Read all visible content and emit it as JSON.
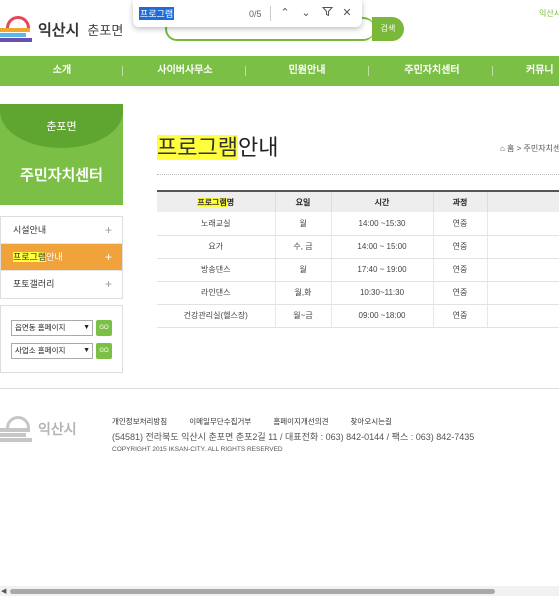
{
  "header": {
    "city": "익산시",
    "town": "춘포면",
    "search_label": "검색",
    "top_link": "익산시"
  },
  "findbar": {
    "query": "프로그램",
    "count": "0/5"
  },
  "nav": {
    "items": [
      "소개",
      "사이버사무소",
      "민원안내",
      "주민자치센터",
      "커뮤니"
    ]
  },
  "sidebar": {
    "town": "춘포면",
    "title": "주민자치센터",
    "items": [
      {
        "label_pre": "시설안내",
        "label_hl": "",
        "label_post": ""
      },
      {
        "label_pre": "",
        "label_hl": "프로그램",
        "label_post": "안내"
      },
      {
        "label_pre": "포토갤러리",
        "label_hl": "",
        "label_post": ""
      }
    ],
    "quick": [
      {
        "selected": "읍면동 홈페이지",
        "go": "GO"
      },
      {
        "selected": "사업소 홈페이지",
        "go": "GO"
      }
    ]
  },
  "main": {
    "title_hl": "프로그램",
    "title_rest": "안내",
    "breadcrumb": "⌂ 홈 > 주민자치센",
    "table": {
      "headers": [
        {
          "hl": "프로그램",
          "rest": "명"
        },
        {
          "hl": "",
          "rest": "요일"
        },
        {
          "hl": "",
          "rest": "시간"
        },
        {
          "hl": "",
          "rest": "과정"
        }
      ],
      "rows": [
        [
          "노래교실",
          "월",
          "14:00 ~15:30",
          "연중"
        ],
        [
          "요가",
          "수, 금",
          "14:00 ~ 15:00",
          "연중"
        ],
        [
          "방송댄스",
          "월",
          "17:40 ~ 19:00",
          "연중"
        ],
        [
          "라인댄스",
          "월,화",
          "10:30~11:30",
          "연중"
        ],
        [
          "건강관리실(헬스장)",
          "월~금",
          "09:00 ~18:00",
          "연중"
        ]
      ]
    }
  },
  "footer": {
    "city": "익산시",
    "links": [
      "개인정보처리방침",
      "이메일무단수집거부",
      "홈페이지개선의견",
      "찾아오시는길"
    ],
    "address": "(54581) 전라북도 익산시 춘포면 춘포2길 11 / 대표전화 : 063) 842-0144 / 팩스 : 063) 842-7435",
    "copyright": "COPYRIGHT 2015 IKSAN-CITY. ALL RIGHTS RESERVED"
  }
}
